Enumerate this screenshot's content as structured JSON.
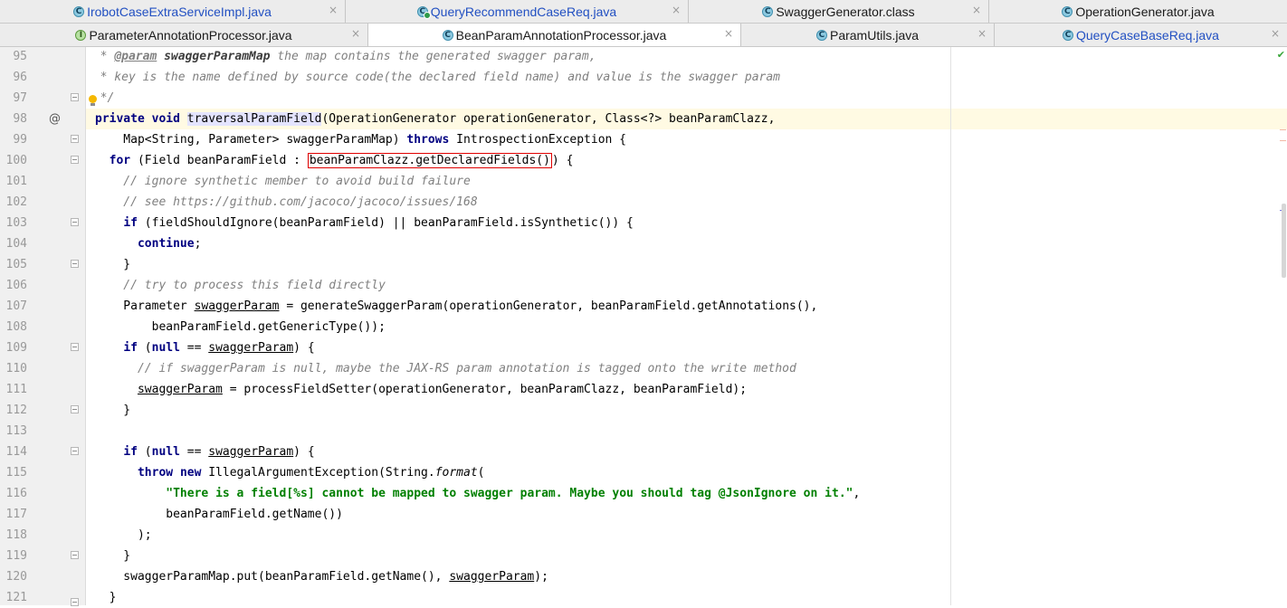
{
  "tabs_row1": [
    {
      "label": "IrobotCaseExtraServiceImpl.java",
      "icon": "class-icon",
      "visited": true
    },
    {
      "label": "QueryRecommendCaseReq.java",
      "icon": "class-icon",
      "visited": true
    },
    {
      "label": "SwaggerGenerator.class",
      "icon": "class-icon",
      "visited": false
    },
    {
      "label": "OperationGenerator.java",
      "icon": "class-icon",
      "visited": false
    }
  ],
  "tabs_row2": [
    {
      "label": "ParameterAnnotationProcessor.java",
      "icon": "interface-icon",
      "visited": false
    },
    {
      "label": "BeanParamAnnotationProcessor.java",
      "icon": "class-icon",
      "visited": false,
      "active": true
    },
    {
      "label": "ParamUtils.java",
      "icon": "class-icon",
      "visited": false
    },
    {
      "label": "QueryCaseBaseReq.java",
      "icon": "class-icon",
      "visited": true
    }
  ],
  "tab_close_glyph": "×",
  "gutter": {
    "line_numbers": [
      "95",
      "96",
      "97",
      "98",
      "99",
      "100",
      "101",
      "102",
      "103",
      "104",
      "105",
      "106",
      "107",
      "108",
      "109",
      "110",
      "111",
      "112",
      "113",
      "114",
      "115",
      "116",
      "117",
      "118",
      "119",
      "120",
      "121"
    ],
    "override_marker": "@"
  },
  "code": {
    "l95": {
      "t1": "  * ",
      "t2": "@param",
      "t3": " ",
      "t4": "swaggerParamMap",
      "t5": " the map contains the generated swagger param,"
    },
    "l96": {
      "t1": "  * key is the name defined by source code(the declared field name) and value is the swagger param"
    },
    "l97": {
      "t1": "  */"
    },
    "l98": {
      "t1": "private",
      "t2": " ",
      "t3": "void",
      "t4": " ",
      "t5": "traversalParamField",
      "t6": "(OperationGenerator operationGenerator, Class<?> beanParamClazz,"
    },
    "l99": {
      "t1": "    Map<String, Parameter> swaggerParamMap) ",
      "t2": "throws",
      "t3": " IntrospectionException {"
    },
    "l100": {
      "t1": "  ",
      "t2": "for",
      "t3": " (Field beanParamField : ",
      "t4": "beanParamClazz.getDeclaredFields()",
      "t5": ") {"
    },
    "l101": {
      "t1": "    // ignore synthetic member to avoid build failure"
    },
    "l102": {
      "t1": "    // see https://github.com/jacoco/jacoco/issues/168"
    },
    "l103": {
      "t1": "    ",
      "t2": "if",
      "t3": " (fieldShouldIgnore(beanParamField) || beanParamField.isSynthetic()) {"
    },
    "l104": {
      "t1": "      ",
      "t2": "continue",
      "t3": ";"
    },
    "l105": {
      "t1": "    }"
    },
    "l106": {
      "t1": "    // try to process this field directly"
    },
    "l107": {
      "t1": "    Parameter ",
      "t2": "swaggerParam",
      "t3": " = generateSwaggerParam(operationGenerator, beanParamField.getAnnotations(),"
    },
    "l108": {
      "t1": "        beanParamField.getGenericType());"
    },
    "l109": {
      "t1": "    ",
      "t2": "if",
      "t3": " (",
      "t4": "null",
      "t5": " == ",
      "t6": "swaggerParam",
      "t7": ") {"
    },
    "l110": {
      "t1": "      // if swaggerParam is null, maybe the JAX-RS param annotation is tagged onto the write method"
    },
    "l111": {
      "t1": "      ",
      "t2": "swaggerParam",
      "t3": " = processFieldSetter(operationGenerator, beanParamClazz, beanParamField);"
    },
    "l112": {
      "t1": "    }"
    },
    "l113": {
      "t1": ""
    },
    "l114": {
      "t1": "    ",
      "t2": "if",
      "t3": " (",
      "t4": "null",
      "t5": " == ",
      "t6": "swaggerParam",
      "t7": ") {"
    },
    "l115": {
      "t1": "      ",
      "t2": "throw",
      "t3": " ",
      "t4": "new",
      "t5": " IllegalArgumentException(String.",
      "t6": "format",
      "t7": "("
    },
    "l116": {
      "t1": "          ",
      "t2": "\"There is a field[%s] cannot be mapped to swagger param. Maybe you should tag @JsonIgnore on it.\"",
      "t3": ","
    },
    "l117": {
      "t1": "          beanParamField.getName())"
    },
    "l118": {
      "t1": "      );"
    },
    "l119": {
      "t1": "    }"
    },
    "l120": {
      "t1": "    swaggerParamMap.put(beanParamField.getName(), ",
      "t2": "swaggerParam",
      "t3": ");"
    },
    "l121": {
      "t1": "  }"
    }
  },
  "status_check": "✔",
  "colors": {
    "keyword": "#000080",
    "string": "#008000",
    "comment": "#808080",
    "highlight_box": "#e00000",
    "caret_line": "#fffae3"
  }
}
